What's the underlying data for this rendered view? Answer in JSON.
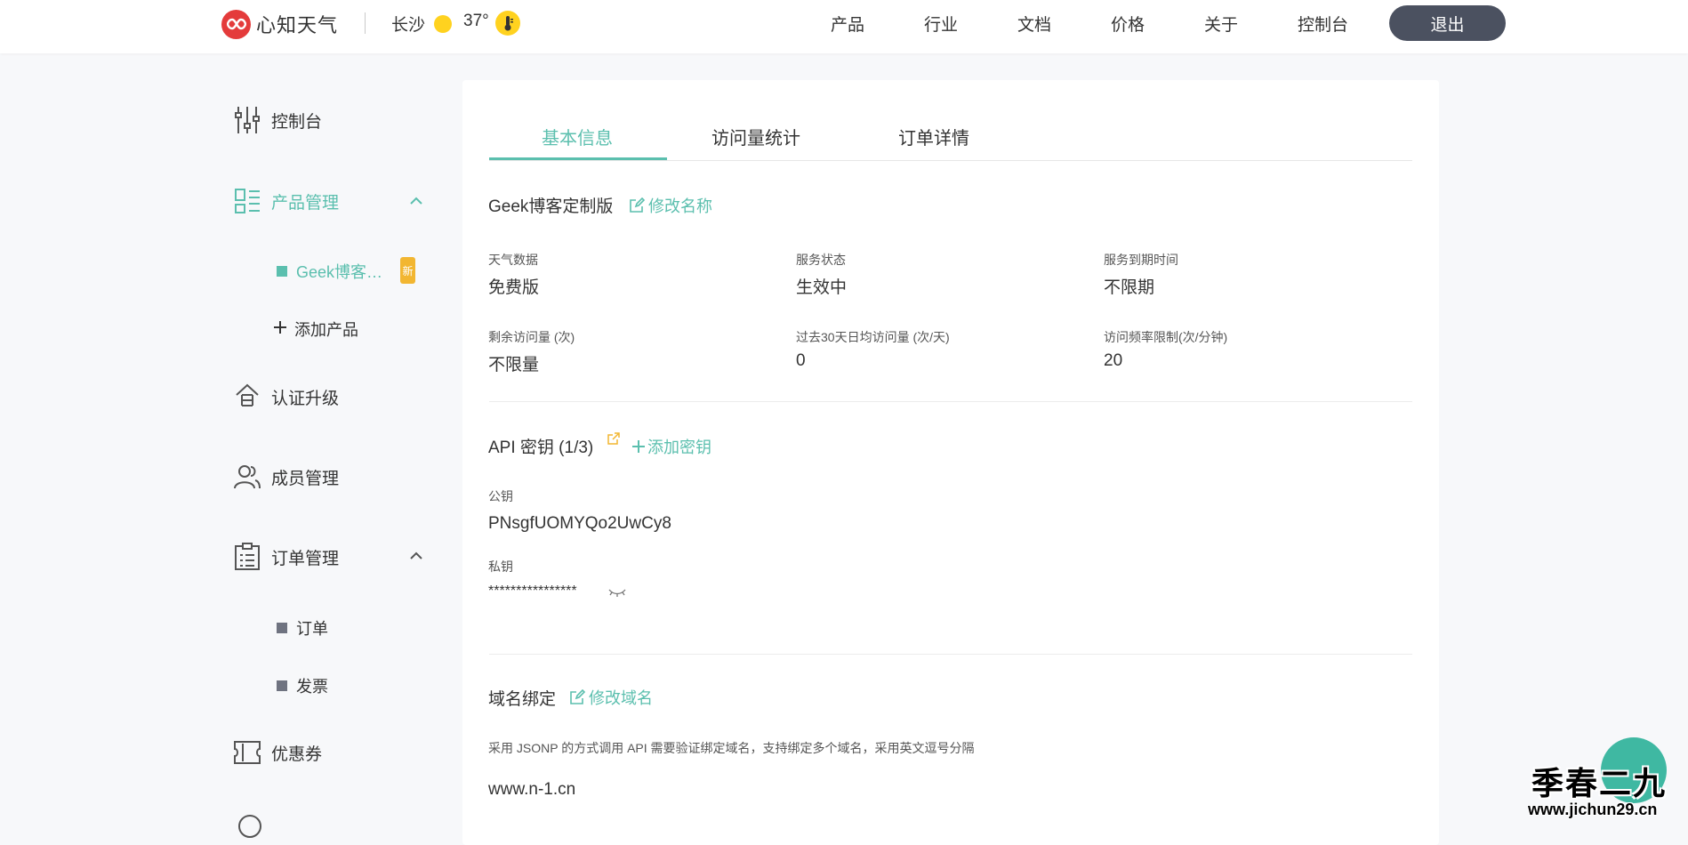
{
  "header": {
    "logo_text": "心知天气",
    "city": "长沙",
    "temperature": "37°",
    "nav": [
      "产品",
      "行业",
      "文档",
      "价格",
      "关于",
      "控制台"
    ],
    "logout_label": "退出",
    "weather_icon": "sun-icon",
    "temp_icon": "thermometer-icon"
  },
  "sidebar": {
    "dashboard": "控制台",
    "product_mgmt": "产品管理",
    "product_item": "Geek博客…",
    "new_badge": "新",
    "add_product": "添加产品",
    "auth_upgrade": "认证升级",
    "member_mgmt": "成员管理",
    "order_mgmt": "订单管理",
    "orders": "订单",
    "invoices": "发票",
    "coupons": "优惠券"
  },
  "tabs": [
    "基本信息",
    "访问量统计",
    "订单详情"
  ],
  "active_tab": 0,
  "product": {
    "name": "Geek博客定制版",
    "rename_link": "修改名称"
  },
  "info_fields": [
    {
      "label": "天气数据",
      "value": "免费版"
    },
    {
      "label": "服务状态",
      "value": "生效中"
    },
    {
      "label": "服务到期时间",
      "value": "不限期"
    },
    {
      "label": "剩余访问量 (次)",
      "value": "不限量"
    },
    {
      "label": "过去30天日均访问量 (次/天)",
      "value": "0"
    },
    {
      "label": "访问频率限制(次/分钟)",
      "value": "20"
    }
  ],
  "api": {
    "title": "API 密钥 (1/3)",
    "add_key_link": "添加密钥",
    "public_key_label": "公钥",
    "public_key": "PNsgfUOMYQo2UwCy8",
    "private_key_label": "私钥",
    "private_key": "****************"
  },
  "domain": {
    "title": "域名绑定",
    "edit_link": "修改域名",
    "hint": "采用 JSONP 的方式调用 API 需要验证绑定域名，支持绑定多个域名，采用英文逗号分隔",
    "value": "www.n-1.cn"
  },
  "watermark": {
    "title": "季春二九",
    "url": "www.jichun29.cn"
  },
  "colors": {
    "accent": "#5bbfae",
    "logout_bg": "#4b5160",
    "badge": "#f2b631",
    "logo": "#e43b3b",
    "sun": "#ffd21f"
  }
}
